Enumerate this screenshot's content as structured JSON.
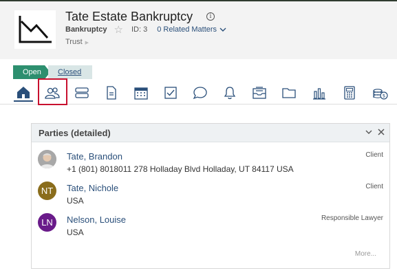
{
  "header": {
    "title": "Tate Estate Bankruptcy",
    "type": "Bankruptcy",
    "id_label": "ID: 3",
    "related_label": "0 Related Matters",
    "sub": "Trust"
  },
  "status": {
    "open": "Open",
    "closed": "Closed",
    "accent": "#2d8f6f"
  },
  "tabs": [
    {
      "name": "home-icon",
      "active": true
    },
    {
      "name": "people-icon"
    },
    {
      "name": "stack-icon"
    },
    {
      "name": "document-icon"
    },
    {
      "name": "calendar-icon"
    },
    {
      "name": "checkbox-icon"
    },
    {
      "name": "chat-bubble-icon"
    },
    {
      "name": "bell-icon"
    },
    {
      "name": "inbox-icon"
    },
    {
      "name": "folder-icon"
    },
    {
      "name": "bar-chart-icon"
    },
    {
      "name": "calculator-icon"
    },
    {
      "name": "coins-icon"
    }
  ],
  "panel": {
    "title": "Parties (detailed)",
    "more_label": "More...",
    "parties": [
      {
        "name": "Tate, Brandon",
        "detail": "+1 (801) 8018011 278 Holladay Blvd Holladay, UT 84117 USA",
        "role": "Client",
        "initials": "",
        "avatar_color": "#9a9a9a"
      },
      {
        "name": "Tate, Nichole",
        "detail": "USA",
        "role": "Client",
        "initials": "NT",
        "avatar_color": "#8a6d1c"
      },
      {
        "name": "Nelson, Louise",
        "detail": "USA",
        "role": "Responsible Lawyer",
        "initials": "LN",
        "avatar_color": "#6a1b8a"
      }
    ]
  }
}
